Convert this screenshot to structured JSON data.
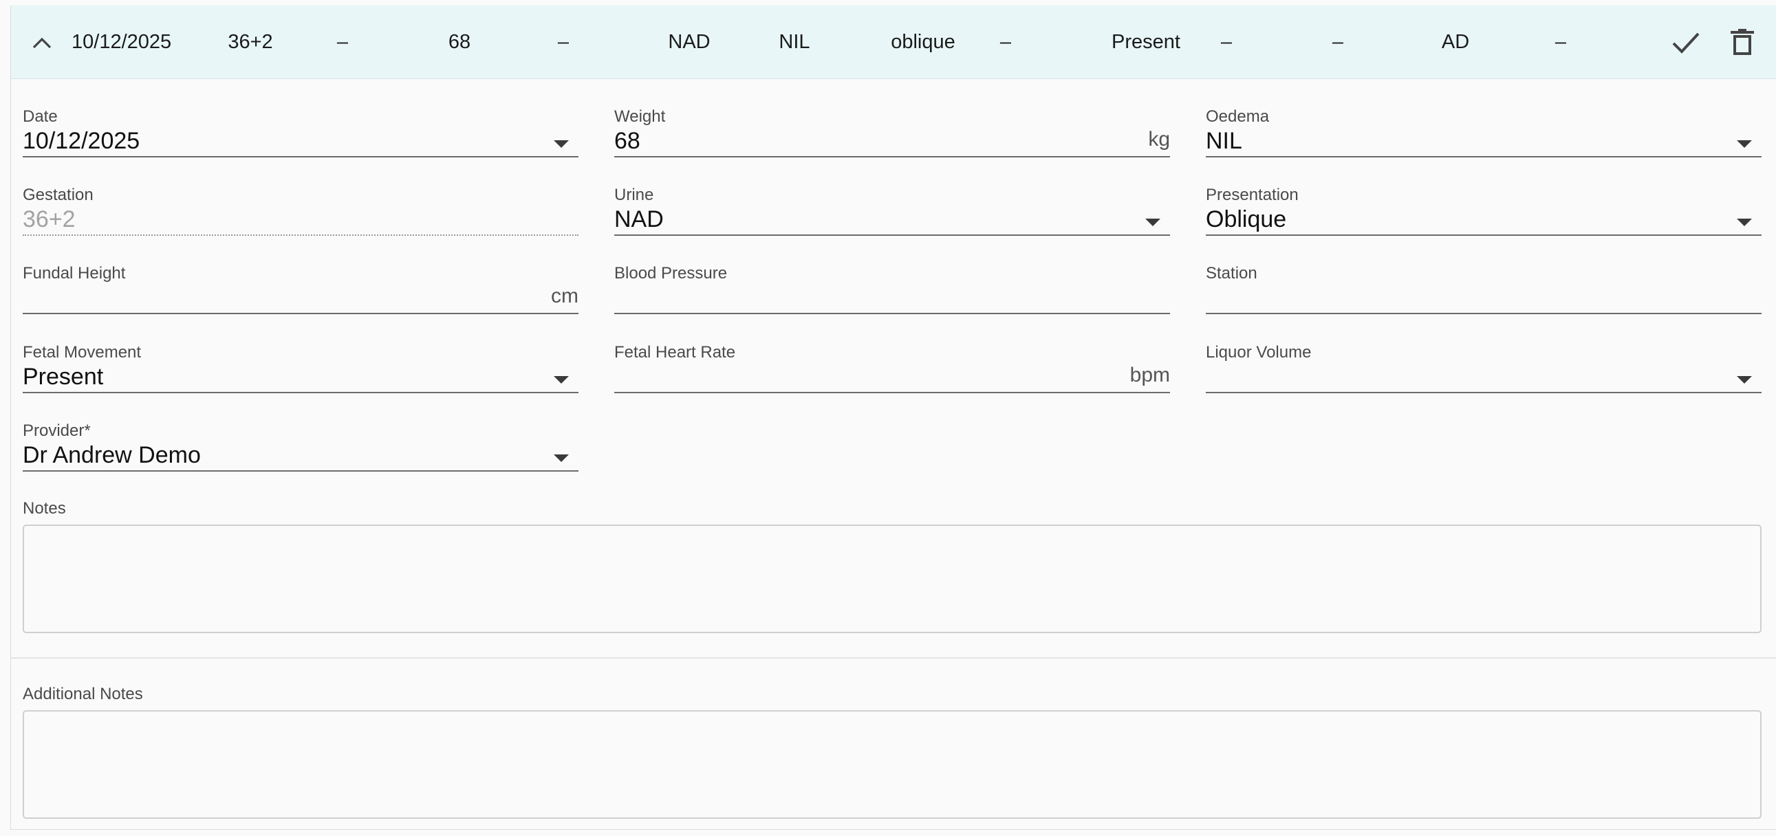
{
  "summary": {
    "date": "10/12/2025",
    "gestation": "36+2",
    "fundal_height": "–",
    "weight": "68",
    "blood_pressure": "–",
    "urine": "NAD",
    "oedema": "NIL",
    "presentation": "oblique",
    "station": "–",
    "fetal_movement": "Present",
    "fetal_heart_rate": "–",
    "liquor_volume": "–",
    "provider": "AD",
    "extra": "–"
  },
  "icons": {
    "collapse": "chevron-up-icon",
    "save": "check-icon",
    "delete": "trash-icon"
  },
  "form": {
    "date": {
      "label": "Date",
      "value": "10/12/2025"
    },
    "weight": {
      "label": "Weight",
      "value": "68",
      "unit": "kg"
    },
    "oedema": {
      "label": "Oedema",
      "value": "NIL"
    },
    "gestation": {
      "label": "Gestation",
      "value": "36+2"
    },
    "urine": {
      "label": "Urine",
      "value": "NAD"
    },
    "presentation": {
      "label": "Presentation",
      "value": "Oblique"
    },
    "fundal_height": {
      "label": "Fundal Height",
      "value": "",
      "unit": "cm"
    },
    "blood_pressure": {
      "label": "Blood Pressure",
      "value": ""
    },
    "station": {
      "label": "Station",
      "value": ""
    },
    "fetal_movement": {
      "label": "Fetal Movement",
      "value": "Present"
    },
    "fetal_heart_rate": {
      "label": "Fetal Heart Rate",
      "value": "",
      "unit": "bpm"
    },
    "liquor_volume": {
      "label": "Liquor Volume",
      "value": ""
    },
    "provider": {
      "label": "Provider*",
      "value": "Dr Andrew Demo"
    },
    "notes": {
      "label": "Notes",
      "value": ""
    },
    "additional_notes": {
      "label": "Additional Notes",
      "value": ""
    }
  },
  "colors": {
    "row_highlight": "#e8f6f7",
    "background": "#fafafa",
    "underline": "#6b6b6b"
  }
}
